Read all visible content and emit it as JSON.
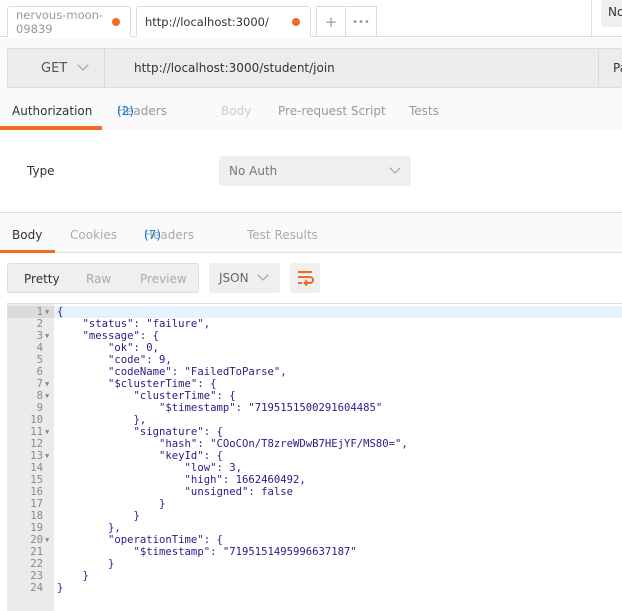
{
  "tabs": [
    {
      "label": "nervous-moon-09839",
      "unsaved": true
    },
    {
      "label": "http://localhost:3000/",
      "unsaved": true
    }
  ],
  "new_tab": "+",
  "more": "•••",
  "env_label": "No",
  "request": {
    "method": "GET",
    "url": "http://localhost:3000/student/join",
    "params_label": "Pa"
  },
  "request_tabs": [
    {
      "label": "Authorization",
      "active": true
    },
    {
      "label": "Headers",
      "count": "(2)"
    },
    {
      "label": "Body",
      "disabled": true
    },
    {
      "label": "Pre-request Script"
    },
    {
      "label": "Tests"
    }
  ],
  "auth": {
    "type_label": "Type",
    "type_value": "No Auth"
  },
  "response_tabs": [
    {
      "label": "Body",
      "active": true
    },
    {
      "label": "Cookies"
    },
    {
      "label": "Headers",
      "count": "(7)"
    },
    {
      "label": "Test Results"
    }
  ],
  "view_modes": [
    "Pretty",
    "Raw",
    "Preview"
  ],
  "active_view": "Pretty",
  "format": "JSON",
  "accent": "#f26b24",
  "code_lines": [
    "{",
    "    \"status\": \"failure\",",
    "    \"message\": {",
    "        \"ok\": 0,",
    "        \"code\": 9,",
    "        \"codeName\": \"FailedToParse\",",
    "        \"$clusterTime\": {",
    "            \"clusterTime\": {",
    "                \"$timestamp\": \"7195151500291604485\"",
    "            },",
    "            \"signature\": {",
    "                \"hash\": \"COoCOn/T8zreWDwB7HEjYF/MS80=\",",
    "                \"keyId\": {",
    "                    \"low\": 3,",
    "                    \"high\": 1662460492,",
    "                    \"unsigned\": false",
    "                }",
    "            }",
    "        },",
    "        \"operationTime\": {",
    "            \"$timestamp\": \"7195151495996637187\"",
    "        }",
    "    }",
    "}"
  ],
  "foldable_lines": [
    1,
    3,
    7,
    8,
    11,
    13,
    20
  ]
}
